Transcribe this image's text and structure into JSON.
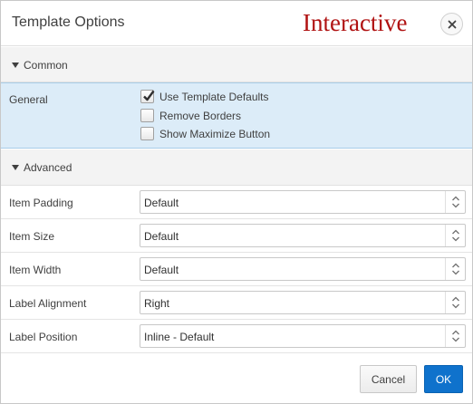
{
  "dialog": {
    "title": "Template Options",
    "watermark": "Interactive",
    "close_icon": "close-icon"
  },
  "common": {
    "header": "Common",
    "general_label": "General",
    "checkboxes": [
      {
        "label": "Use Template Defaults",
        "checked": true
      },
      {
        "label": "Remove Borders",
        "checked": false
      },
      {
        "label": "Show Maximize Button",
        "checked": false
      }
    ]
  },
  "advanced": {
    "header": "Advanced",
    "rows": [
      {
        "label": "Item Padding",
        "value": "Default"
      },
      {
        "label": "Item Size",
        "value": "Default"
      },
      {
        "label": "Item Width",
        "value": "Default"
      },
      {
        "label": "Label Alignment",
        "value": "Right"
      },
      {
        "label": "Label Position",
        "value": "Inline - Default"
      }
    ]
  },
  "footer": {
    "cancel_label": "Cancel",
    "ok_label": "OK"
  },
  "colors": {
    "accent": "#0f72cc",
    "selected_row_bg": "#dcecf8",
    "watermark": "#b01212"
  }
}
